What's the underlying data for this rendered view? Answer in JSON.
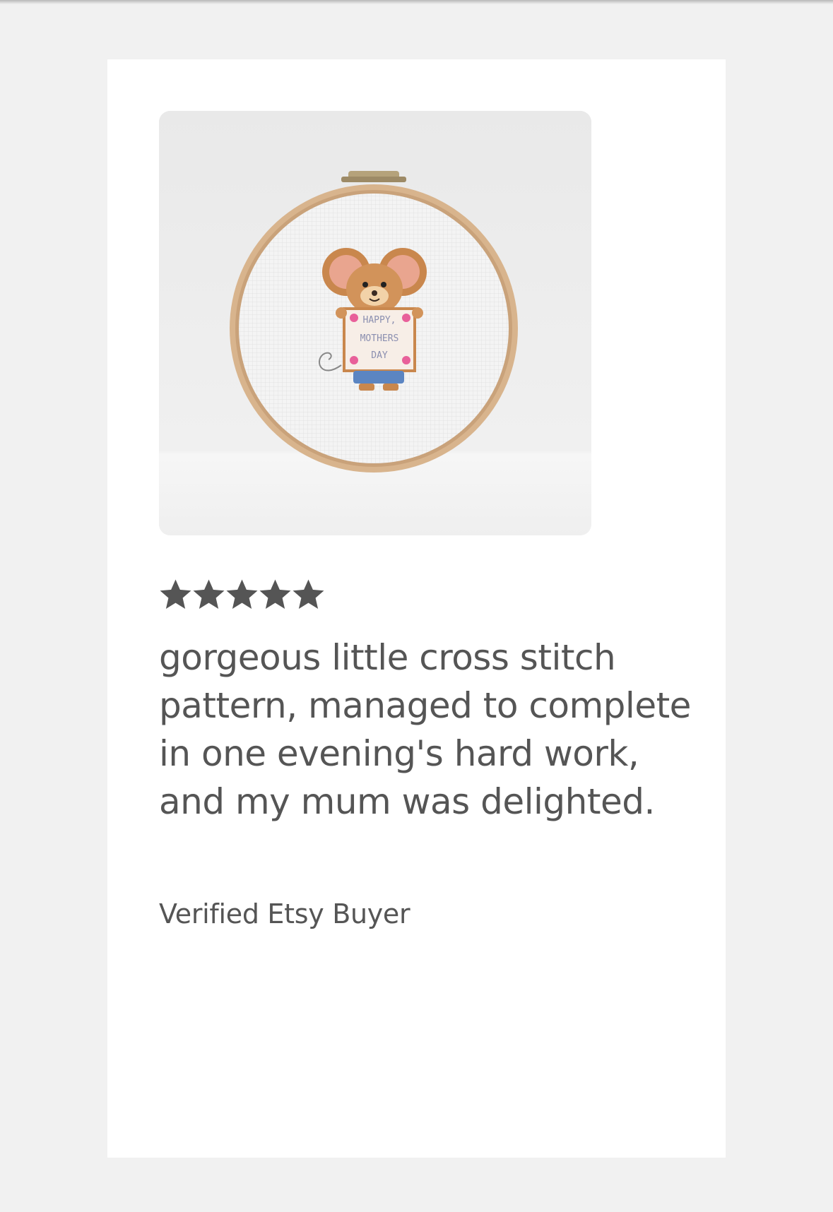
{
  "review": {
    "image_alt_icon": "cross-stitch-hoop-image",
    "image_text": [
      "HAPPY,",
      "MOTHERS",
      "DAY"
    ],
    "rating": 5,
    "rating_max": 5,
    "text": "gorgeous little cross stitch pattern, managed to complete in one evening's hard work, and my mum was delighted.",
    "reviewer": "Verified Etsy Buyer"
  },
  "colors": {
    "page_background": "#f1f1f1",
    "card_background": "#ffffff",
    "text": "#555555",
    "star": "#555555"
  }
}
